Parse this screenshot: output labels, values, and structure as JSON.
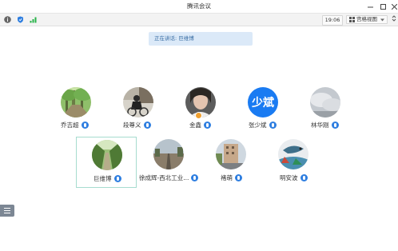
{
  "window": {
    "title": "腾讯会议",
    "controls": [
      "minimize-icon",
      "maximize-icon",
      "close-icon"
    ]
  },
  "toolbar": {
    "icons": [
      "info-icon",
      "shield-icon",
      "signal-icon"
    ],
    "time": "19:06",
    "view_label": "宫格视图",
    "view_icon": "grid-icon",
    "expand_icon": "fullscreen-icon"
  },
  "banner": {
    "speaking_text": "正在讲话: 巨维博"
  },
  "participants": [
    {
      "name": "乔吉超",
      "mic": "mic-active-icon",
      "avatar": "photo-green-trees"
    },
    {
      "name": "段尊义",
      "mic": "mic-active-icon",
      "avatar": "photo-cyclist"
    },
    {
      "name": "金鑫",
      "mic": "mic-active-icon",
      "avatar": "photo-portrait",
      "badge": true
    },
    {
      "name": "张少斌",
      "mic": "mic-active-icon",
      "avatar_text": "少斌"
    },
    {
      "name": "林华刚",
      "mic": "mic-active-icon",
      "avatar": "photo-cloudy-sky"
    },
    {
      "name": "巨维博",
      "mic": "mic-active-icon",
      "avatar": "photo-tree-path",
      "active": true
    },
    {
      "name": "徐成辉-西北工业...",
      "mic": "mic-active-icon",
      "avatar": "photo-railway"
    },
    {
      "name": "褚萌",
      "mic": "mic-active-icon",
      "avatar": "photo-street-building"
    },
    {
      "name": "明安波",
      "mic": "mic-active-icon",
      "avatar": "photo-fish-painting"
    }
  ],
  "colors": {
    "accent_blue": "#1a7bf2",
    "mic_blue": "#2e7ee0",
    "banner_bg": "#dbe9f8",
    "active_border": "#a6dccf"
  },
  "sidebar": {
    "toggle_icon": "list-icon"
  }
}
